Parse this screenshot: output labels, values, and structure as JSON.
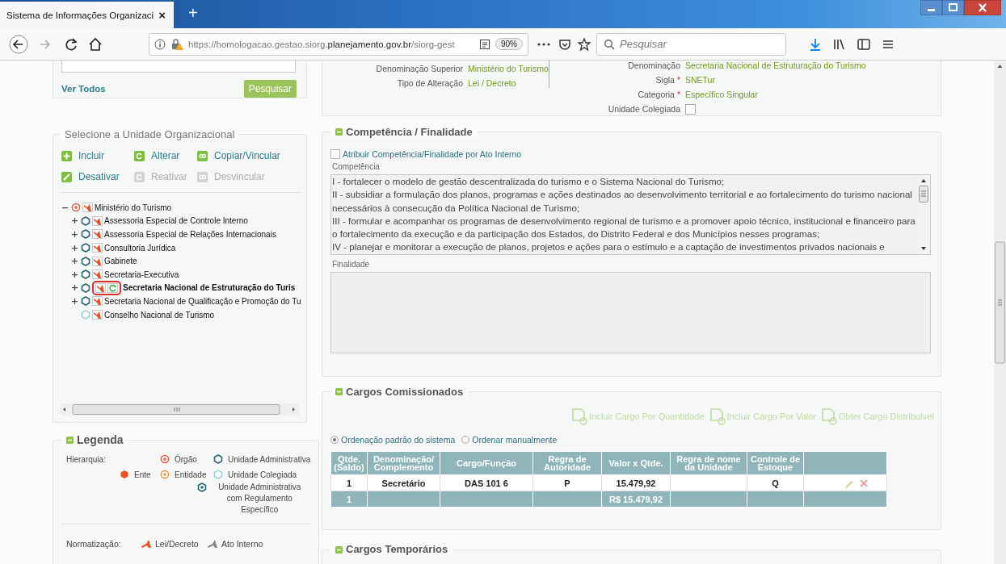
{
  "browser": {
    "tab_title": "Sistema de Informações Organizaci",
    "tab_close": "×",
    "new_tab": "+",
    "url": "https://homologacao.gestao.siorg.**planejamento.gov.br**/siorg-gest",
    "zoom": "90%",
    "search_placeholder": "Pesquisar"
  },
  "search_panel": {
    "link": "Ver Todos",
    "button": "Pesquisar"
  },
  "tree_panel": {
    "title": "Selecione a Unidade Organizacional",
    "actions": [
      {
        "label": "Incluir",
        "disabled": false
      },
      {
        "label": "Alterar",
        "disabled": false
      },
      {
        "label": "Copiar/Vincular",
        "disabled": false
      },
      {
        "label": "Desativar",
        "disabled": false
      },
      {
        "label": "Reativar",
        "disabled": true
      },
      {
        "label": "Desvincular",
        "disabled": true
      }
    ],
    "tree": {
      "label": "Ministério do Turismo",
      "kind": "orgao",
      "expanded": true,
      "selected": false,
      "children": [
        {
          "label": "Assessoria Especial de Controle Interno",
          "kind": "unidade_administrativa",
          "expanded": false,
          "selected": false
        },
        {
          "label": "Assessoria Especial de Relações Internacionais",
          "kind": "unidade_administrativa",
          "expanded": false,
          "selected": false
        },
        {
          "label": "Consultoria Jurídica",
          "kind": "unidade_administrativa",
          "expanded": false,
          "selected": false
        },
        {
          "label": "Gabinete",
          "kind": "unidade_administrativa",
          "expanded": false,
          "selected": false
        },
        {
          "label": "Secretaria-Executiva",
          "kind": "unidade_administrativa",
          "expanded": false,
          "selected": false
        },
        {
          "label": "Secretaria Nacional de Estruturação do Turis",
          "kind": "unidade_administrativa",
          "expanded": false,
          "selected": true
        },
        {
          "label": "Secretaria Nacional de Qualificação e Promoção do Tu",
          "kind": "unidade_administrativa",
          "expanded": false,
          "selected": false
        },
        {
          "label": "Conselho Nacional de Turismo",
          "kind": "unidade_colegiada",
          "selected": false
        }
      ]
    }
  },
  "legend": {
    "title": "Legenda",
    "hierarchy_label": "Hierarquia:",
    "hierarchy": [
      {
        "kind": "orgao",
        "label": "Órgão"
      },
      {
        "kind": "unidade_administrativa",
        "label": "Unidade Administrativa"
      },
      {
        "kind": "ente",
        "label": "Ente"
      },
      {
        "kind": "entidade",
        "label": "Entidade"
      },
      {
        "kind": "unidade_colegiada",
        "label": "Unidade Colegiada"
      },
      {
        "kind": "unidade_regulamento",
        "label": "Unidade Administrativa com Regulamento Específico"
      }
    ],
    "norm_label": "Normatização:",
    "norms": [
      {
        "kind": "lei",
        "label": "Lei/Decreto"
      },
      {
        "kind": "ato",
        "label": "Ato Interno"
      }
    ]
  },
  "details": {
    "left_fields": [
      {
        "label": "Denominação Superior",
        "value": "Ministério do Turismo"
      },
      {
        "label": "Tipo de Alteração",
        "value": "Lei / Decreto"
      }
    ],
    "right_fields": [
      {
        "kind": "text",
        "label": "Denominação",
        "value": "Secretaria Nacional de Estruturação do Turismo"
      },
      {
        "kind": "text",
        "label": "Sigla",
        "marker": "*",
        "value": "SNETur"
      },
      {
        "kind": "text",
        "label": "Categoria",
        "marker": "*",
        "value": "Específico Singular"
      },
      {
        "kind": "checkbox",
        "label": "Unidade Colegiada",
        "checked": false
      }
    ]
  },
  "competencia": {
    "title": "Competência / Finalidade",
    "checkbox": {
      "label": "Atribuir Competência/Finalidade por Ato Interno",
      "checked": false
    },
    "competencia_label": "Competência",
    "competencia_text": [
      "I - fortalecer o modelo de gestão descentralizada do turismo e o Sistema Nacional do Turismo;",
      "II - subsidiar a formulação dos planos, programas e ações destinados ao desenvolvimento territorial e ao fortalecimento do turismo nacional necessários à consecução da Política Nacional de Turismo;",
      "III - formular e acompanhar os programas de desenvolvimento regional de turismo e a promover apoio técnico, institucional e financeiro para o fortalecimento da execução e da participação dos Estados, do Distrito Federal e dos Municípios nesses programas;",
      "IV - planejar e monitorar a execução de planos, projetos e ações para o estímulo e a captação de investimentos privados nacionais e"
    ],
    "finalidade_label": "Finalidade"
  },
  "cargos": {
    "title": "Cargos Comissionados",
    "actions": [
      {
        "label": "Incluir Cargo Por Quantidade",
        "disabled": true
      },
      {
        "label": "Incluir Cargo Por Valor",
        "disabled": true
      },
      {
        "label": "Obter Cargo Distribuível",
        "disabled": true
      }
    ],
    "ordering": [
      {
        "label": "Ordenação padrão do sistema",
        "selected": true
      },
      {
        "label": "Ordenar manualmente",
        "selected": false
      }
    ],
    "table": {
      "columns": [
        "Qtde. (Saldo)",
        "Denominação/ Complemento",
        "Cargo/Função",
        "Regra de Autoridade",
        "Valor x Qtde.",
        "Regra de nome da Unidade",
        "Controle de Estoque"
      ],
      "rows": [
        {
          "quantity": "1",
          "denomination": "Secretário",
          "role": "DAS 101 6",
          "authority_rule": "P",
          "value": "15.479,92",
          "stock_control": "Q"
        }
      ],
      "total": {
        "quantity": "1",
        "value": "R$ 15.479,92"
      }
    }
  },
  "next_section": {
    "title": "Cargos Temporários"
  }
}
